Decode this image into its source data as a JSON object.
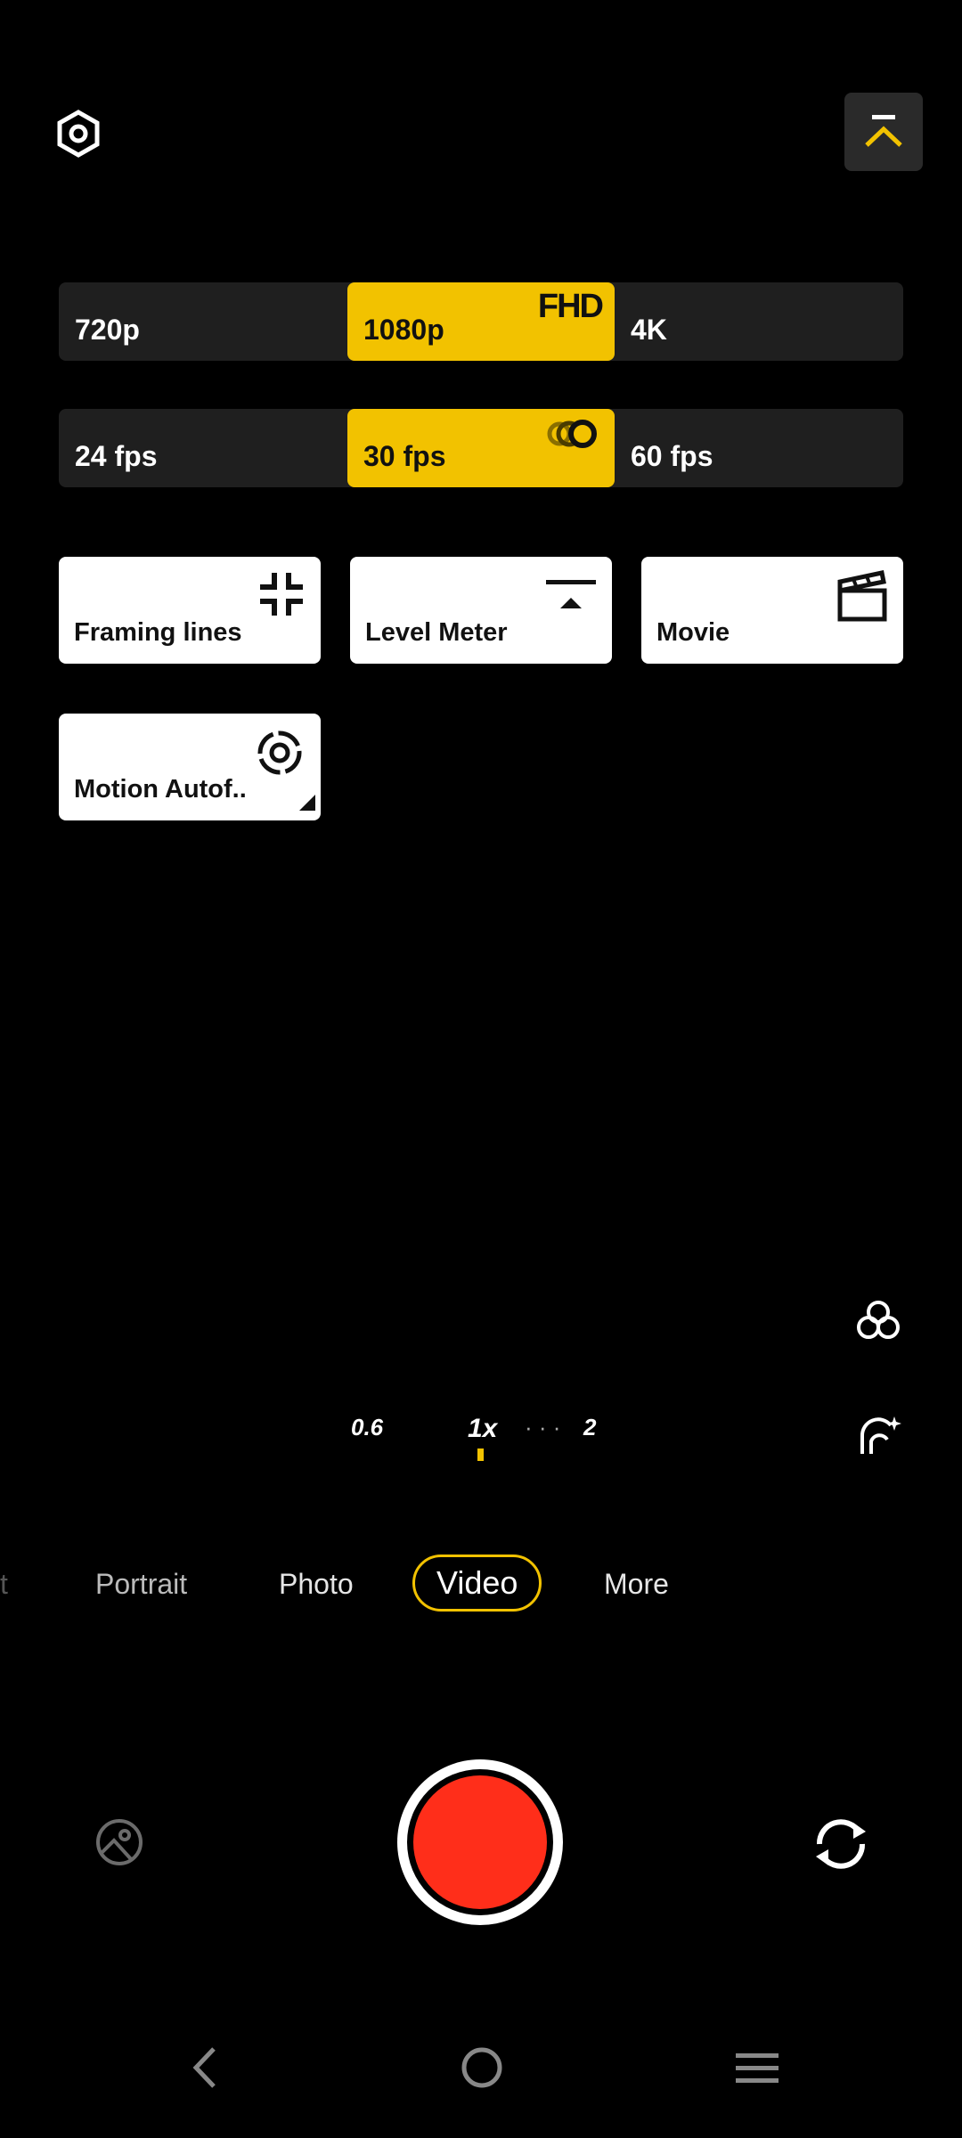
{
  "resolution": {
    "options": [
      "720p",
      "1080p",
      "4K"
    ],
    "selected": "1080p",
    "selected_badge": "FHD"
  },
  "framerate": {
    "options": [
      "24 fps",
      "30 fps",
      "60 fps"
    ],
    "selected": "30 fps"
  },
  "tiles": [
    {
      "label": "Framing lines",
      "icon": "framing-lines-icon"
    },
    {
      "label": "Level Meter",
      "icon": "level-meter-icon"
    },
    {
      "label": "Movie",
      "icon": "clapperboard-icon"
    },
    {
      "label": "Motion Autof..",
      "icon": "motion-autofocus-icon"
    }
  ],
  "zoom": {
    "levels": [
      "0.6",
      "1x",
      "2"
    ],
    "selected": "1x",
    "dots": "· · ·"
  },
  "modes": {
    "items": [
      "t",
      "Portrait",
      "Photo",
      "Video",
      "More"
    ],
    "selected": "Video"
  },
  "colors": {
    "accent": "#f2c200",
    "record": "#ff2e1a",
    "panel": "#1f1f1f"
  }
}
